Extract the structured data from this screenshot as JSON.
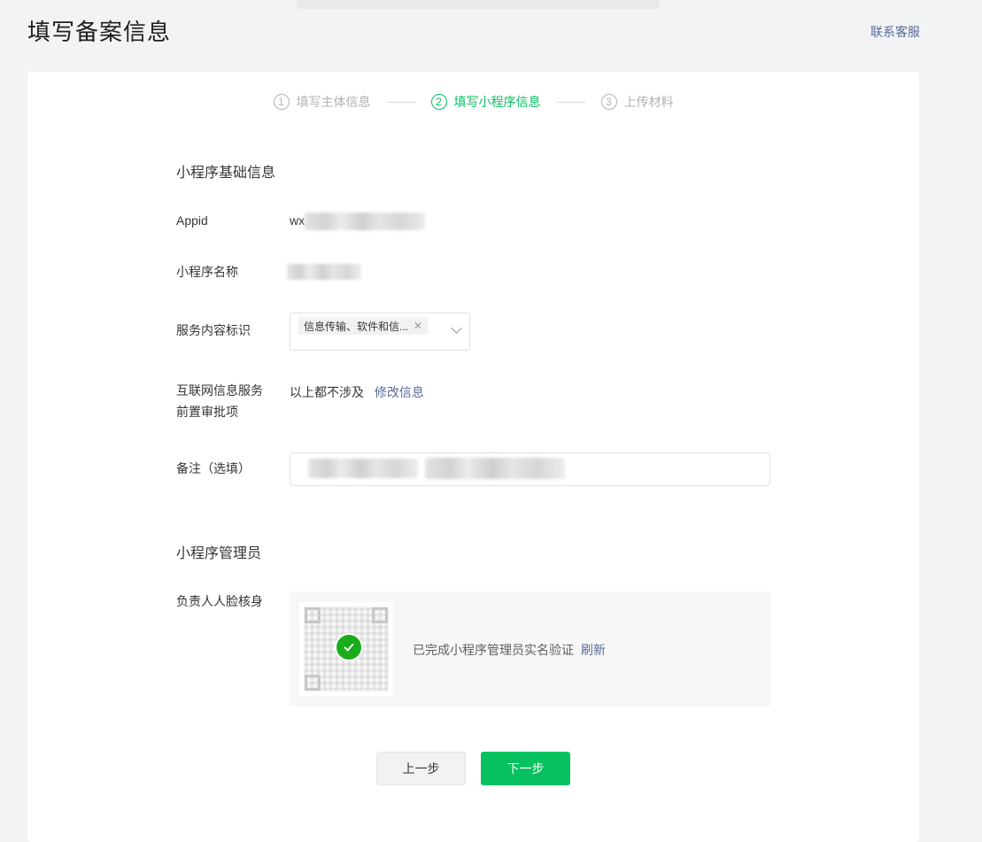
{
  "header": {
    "title": "填写备案信息",
    "contact": "联系客服"
  },
  "steps": [
    {
      "num": "1",
      "label": "填写主体信息",
      "state": "inactive"
    },
    {
      "num": "2",
      "label": "填写小程序信息",
      "state": "active"
    },
    {
      "num": "3",
      "label": "上传材料",
      "state": "inactive"
    }
  ],
  "basic": {
    "section_title": "小程序基础信息",
    "appid_label": "Appid",
    "appid_prefix": "wx",
    "name_label": "小程序名称",
    "service_label": "服务内容标识",
    "service_tag": "信息传输、软件和信...",
    "prereq_label_line1": "互联网信息服务",
    "prereq_label_line2": "前置审批项",
    "prereq_value": "以上都不涉及",
    "prereq_link": "修改信息",
    "remark_label": "备注（选填）"
  },
  "admin": {
    "section_title": "小程序管理员",
    "face_label": "负责人人脸核身",
    "verify_text": "已完成小程序管理员实名验证",
    "refresh_link": "刷新"
  },
  "buttons": {
    "prev": "上一步",
    "next": "下一步"
  },
  "colors": {
    "accent": "#07c160",
    "link": "#576b95",
    "check": "#1aad19"
  }
}
